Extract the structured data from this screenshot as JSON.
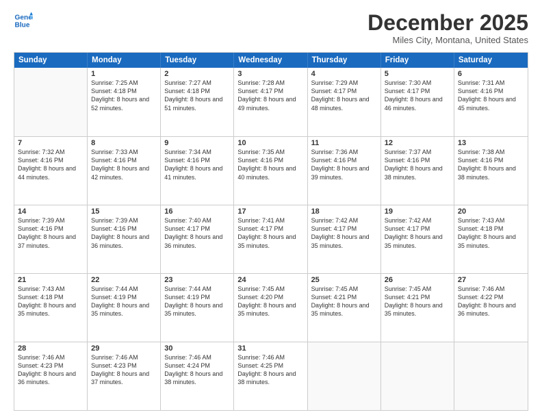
{
  "logo": {
    "line1": "General",
    "line2": "Blue"
  },
  "title": "December 2025",
  "subtitle": "Miles City, Montana, United States",
  "header_days": [
    "Sunday",
    "Monday",
    "Tuesday",
    "Wednesday",
    "Thursday",
    "Friday",
    "Saturday"
  ],
  "weeks": [
    [
      {
        "day": "",
        "empty": true
      },
      {
        "day": "1",
        "sunrise": "Sunrise: 7:25 AM",
        "sunset": "Sunset: 4:18 PM",
        "daylight": "Daylight: 8 hours and 52 minutes."
      },
      {
        "day": "2",
        "sunrise": "Sunrise: 7:27 AM",
        "sunset": "Sunset: 4:18 PM",
        "daylight": "Daylight: 8 hours and 51 minutes."
      },
      {
        "day": "3",
        "sunrise": "Sunrise: 7:28 AM",
        "sunset": "Sunset: 4:17 PM",
        "daylight": "Daylight: 8 hours and 49 minutes."
      },
      {
        "day": "4",
        "sunrise": "Sunrise: 7:29 AM",
        "sunset": "Sunset: 4:17 PM",
        "daylight": "Daylight: 8 hours and 48 minutes."
      },
      {
        "day": "5",
        "sunrise": "Sunrise: 7:30 AM",
        "sunset": "Sunset: 4:17 PM",
        "daylight": "Daylight: 8 hours and 46 minutes."
      },
      {
        "day": "6",
        "sunrise": "Sunrise: 7:31 AM",
        "sunset": "Sunset: 4:16 PM",
        "daylight": "Daylight: 8 hours and 45 minutes."
      }
    ],
    [
      {
        "day": "7",
        "sunrise": "Sunrise: 7:32 AM",
        "sunset": "Sunset: 4:16 PM",
        "daylight": "Daylight: 8 hours and 44 minutes."
      },
      {
        "day": "8",
        "sunrise": "Sunrise: 7:33 AM",
        "sunset": "Sunset: 4:16 PM",
        "daylight": "Daylight: 8 hours and 42 minutes."
      },
      {
        "day": "9",
        "sunrise": "Sunrise: 7:34 AM",
        "sunset": "Sunset: 4:16 PM",
        "daylight": "Daylight: 8 hours and 41 minutes."
      },
      {
        "day": "10",
        "sunrise": "Sunrise: 7:35 AM",
        "sunset": "Sunset: 4:16 PM",
        "daylight": "Daylight: 8 hours and 40 minutes."
      },
      {
        "day": "11",
        "sunrise": "Sunrise: 7:36 AM",
        "sunset": "Sunset: 4:16 PM",
        "daylight": "Daylight: 8 hours and 39 minutes."
      },
      {
        "day": "12",
        "sunrise": "Sunrise: 7:37 AM",
        "sunset": "Sunset: 4:16 PM",
        "daylight": "Daylight: 8 hours and 38 minutes."
      },
      {
        "day": "13",
        "sunrise": "Sunrise: 7:38 AM",
        "sunset": "Sunset: 4:16 PM",
        "daylight": "Daylight: 8 hours and 38 minutes."
      }
    ],
    [
      {
        "day": "14",
        "sunrise": "Sunrise: 7:39 AM",
        "sunset": "Sunset: 4:16 PM",
        "daylight": "Daylight: 8 hours and 37 minutes."
      },
      {
        "day": "15",
        "sunrise": "Sunrise: 7:39 AM",
        "sunset": "Sunset: 4:16 PM",
        "daylight": "Daylight: 8 hours and 36 minutes."
      },
      {
        "day": "16",
        "sunrise": "Sunrise: 7:40 AM",
        "sunset": "Sunset: 4:17 PM",
        "daylight": "Daylight: 8 hours and 36 minutes."
      },
      {
        "day": "17",
        "sunrise": "Sunrise: 7:41 AM",
        "sunset": "Sunset: 4:17 PM",
        "daylight": "Daylight: 8 hours and 35 minutes."
      },
      {
        "day": "18",
        "sunrise": "Sunrise: 7:42 AM",
        "sunset": "Sunset: 4:17 PM",
        "daylight": "Daylight: 8 hours and 35 minutes."
      },
      {
        "day": "19",
        "sunrise": "Sunrise: 7:42 AM",
        "sunset": "Sunset: 4:17 PM",
        "daylight": "Daylight: 8 hours and 35 minutes."
      },
      {
        "day": "20",
        "sunrise": "Sunrise: 7:43 AM",
        "sunset": "Sunset: 4:18 PM",
        "daylight": "Daylight: 8 hours and 35 minutes."
      }
    ],
    [
      {
        "day": "21",
        "sunrise": "Sunrise: 7:43 AM",
        "sunset": "Sunset: 4:18 PM",
        "daylight": "Daylight: 8 hours and 35 minutes."
      },
      {
        "day": "22",
        "sunrise": "Sunrise: 7:44 AM",
        "sunset": "Sunset: 4:19 PM",
        "daylight": "Daylight: 8 hours and 35 minutes."
      },
      {
        "day": "23",
        "sunrise": "Sunrise: 7:44 AM",
        "sunset": "Sunset: 4:19 PM",
        "daylight": "Daylight: 8 hours and 35 minutes."
      },
      {
        "day": "24",
        "sunrise": "Sunrise: 7:45 AM",
        "sunset": "Sunset: 4:20 PM",
        "daylight": "Daylight: 8 hours and 35 minutes."
      },
      {
        "day": "25",
        "sunrise": "Sunrise: 7:45 AM",
        "sunset": "Sunset: 4:21 PM",
        "daylight": "Daylight: 8 hours and 35 minutes."
      },
      {
        "day": "26",
        "sunrise": "Sunrise: 7:45 AM",
        "sunset": "Sunset: 4:21 PM",
        "daylight": "Daylight: 8 hours and 35 minutes."
      },
      {
        "day": "27",
        "sunrise": "Sunrise: 7:46 AM",
        "sunset": "Sunset: 4:22 PM",
        "daylight": "Daylight: 8 hours and 36 minutes."
      }
    ],
    [
      {
        "day": "28",
        "sunrise": "Sunrise: 7:46 AM",
        "sunset": "Sunset: 4:23 PM",
        "daylight": "Daylight: 8 hours and 36 minutes."
      },
      {
        "day": "29",
        "sunrise": "Sunrise: 7:46 AM",
        "sunset": "Sunset: 4:23 PM",
        "daylight": "Daylight: 8 hours and 37 minutes."
      },
      {
        "day": "30",
        "sunrise": "Sunrise: 7:46 AM",
        "sunset": "Sunset: 4:24 PM",
        "daylight": "Daylight: 8 hours and 38 minutes."
      },
      {
        "day": "31",
        "sunrise": "Sunrise: 7:46 AM",
        "sunset": "Sunset: 4:25 PM",
        "daylight": "Daylight: 8 hours and 38 minutes."
      },
      {
        "day": "",
        "empty": true
      },
      {
        "day": "",
        "empty": true
      },
      {
        "day": "",
        "empty": true
      }
    ]
  ]
}
